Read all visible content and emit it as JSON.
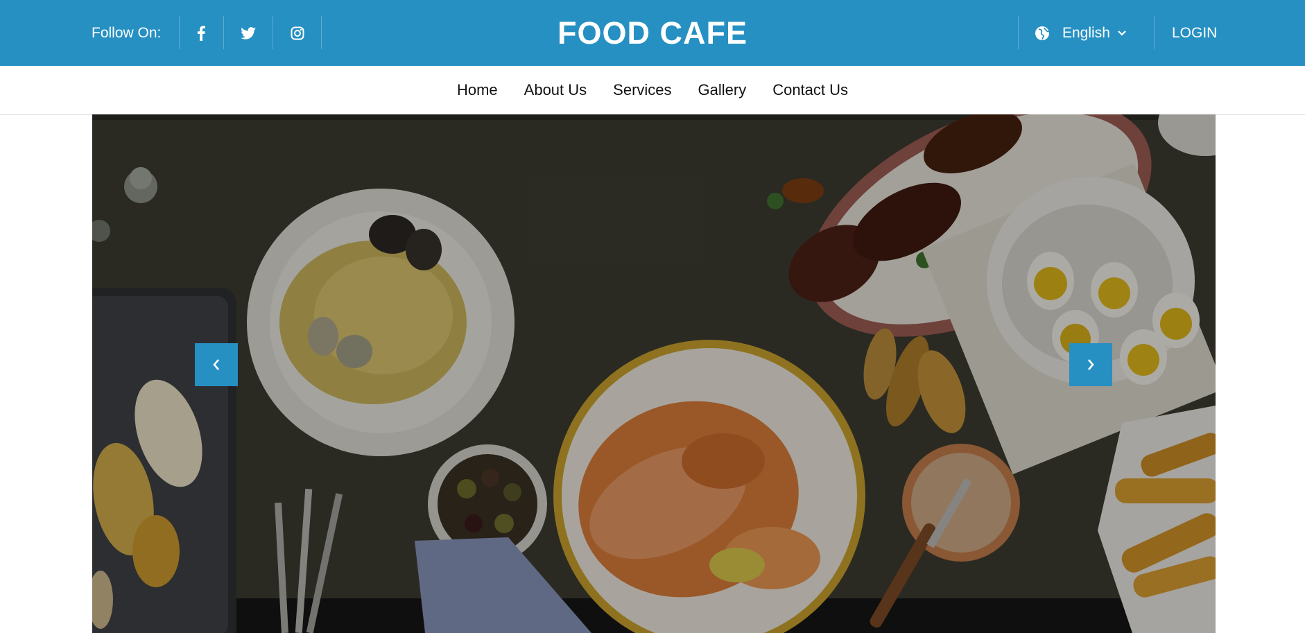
{
  "topbar": {
    "follow_label": "Follow On:",
    "social": [
      {
        "name": "facebook-icon"
      },
      {
        "name": "twitter-icon"
      },
      {
        "name": "instagram-icon"
      }
    ],
    "brand": "FOOD CAFE",
    "language": "English",
    "login": "LOGIN"
  },
  "nav": {
    "items": [
      "Home",
      "About Us",
      "Services",
      "Gallery",
      "Contact Us"
    ]
  },
  "hero": {
    "prev_icon": "chevron-left-icon",
    "next_icon": "chevron-right-icon"
  },
  "colors": {
    "brand_blue": "#2690c2",
    "white": "#ffffff",
    "nav_text": "#111111"
  }
}
